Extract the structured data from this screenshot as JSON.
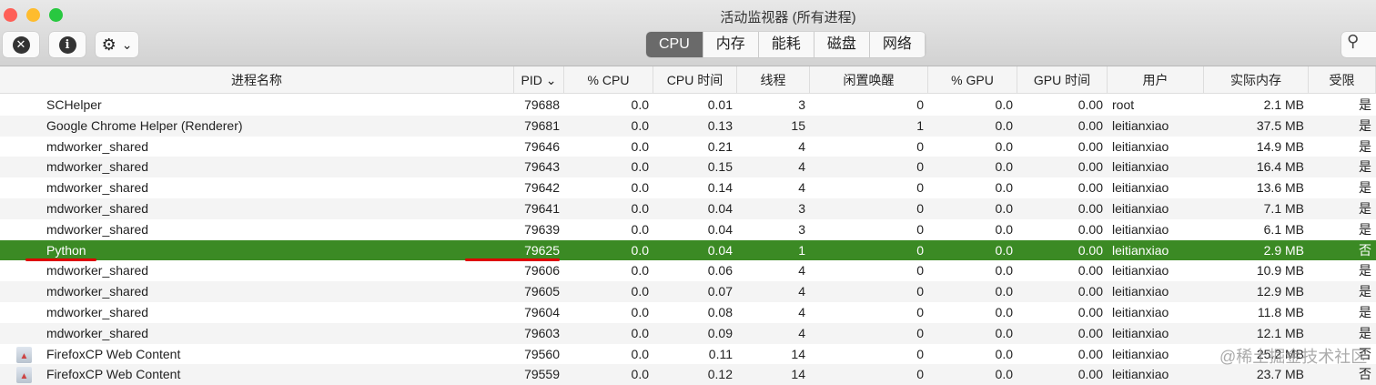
{
  "window": {
    "title": "活动监视器 (所有进程)"
  },
  "toolbar": {
    "stop_icon": "✕",
    "info_icon": "i",
    "gear_icon": "⚙",
    "chevron": "⌄",
    "search_icon": "⚲",
    "tabs": [
      "CPU",
      "内存",
      "能耗",
      "磁盘",
      "网络"
    ],
    "active_tab": "CPU"
  },
  "columns": [
    "进程名称",
    "PID ⌄",
    "% CPU",
    "CPU 时间",
    "线程",
    "闲置唤醒",
    "% GPU",
    "GPU 时间",
    "用户",
    "实际内存",
    "受限"
  ],
  "rows": [
    [
      "SCHelper",
      "79688",
      "0.0",
      "0.01",
      "3",
      "0",
      "0.0",
      "0.00",
      "root",
      "2.1 MB",
      "是"
    ],
    [
      "Google Chrome Helper (Renderer)",
      "79681",
      "0.0",
      "0.13",
      "15",
      "1",
      "0.0",
      "0.00",
      "leitianxiao",
      "37.5 MB",
      "是"
    ],
    [
      "mdworker_shared",
      "79646",
      "0.0",
      "0.21",
      "4",
      "0",
      "0.0",
      "0.00",
      "leitianxiao",
      "14.9 MB",
      "是"
    ],
    [
      "mdworker_shared",
      "79643",
      "0.0",
      "0.15",
      "4",
      "0",
      "0.0",
      "0.00",
      "leitianxiao",
      "16.4 MB",
      "是"
    ],
    [
      "mdworker_shared",
      "79642",
      "0.0",
      "0.14",
      "4",
      "0",
      "0.0",
      "0.00",
      "leitianxiao",
      "13.6 MB",
      "是"
    ],
    [
      "mdworker_shared",
      "79641",
      "0.0",
      "0.04",
      "3",
      "0",
      "0.0",
      "0.00",
      "leitianxiao",
      "7.1 MB",
      "是"
    ],
    [
      "mdworker_shared",
      "79639",
      "0.0",
      "0.04",
      "3",
      "0",
      "0.0",
      "0.00",
      "leitianxiao",
      "6.1 MB",
      "是"
    ],
    [
      "Python",
      "79625",
      "0.0",
      "0.04",
      "1",
      "0",
      "0.0",
      "0.00",
      "leitianxiao",
      "2.9 MB",
      "否"
    ],
    [
      "mdworker_shared",
      "79606",
      "0.0",
      "0.06",
      "4",
      "0",
      "0.0",
      "0.00",
      "leitianxiao",
      "10.9 MB",
      "是"
    ],
    [
      "mdworker_shared",
      "79605",
      "0.0",
      "0.07",
      "4",
      "0",
      "0.0",
      "0.00",
      "leitianxiao",
      "12.9 MB",
      "是"
    ],
    [
      "mdworker_shared",
      "79604",
      "0.0",
      "0.08",
      "4",
      "0",
      "0.0",
      "0.00",
      "leitianxiao",
      "11.8 MB",
      "是"
    ],
    [
      "mdworker_shared",
      "79603",
      "0.0",
      "0.09",
      "4",
      "0",
      "0.0",
      "0.00",
      "leitianxiao",
      "12.1 MB",
      "是"
    ],
    [
      "FirefoxCP Web Content",
      "79560",
      "0.0",
      "0.11",
      "14",
      "0",
      "0.0",
      "0.00",
      "leitianxiao",
      "25.2 MB",
      "否"
    ],
    [
      "FirefoxCP Web Content",
      "79559",
      "0.0",
      "0.12",
      "14",
      "0",
      "0.0",
      "0.00",
      "leitianxiao",
      "23.7 MB",
      "否"
    ]
  ],
  "selected_row": 7,
  "icon_rows": [
    12,
    13
  ],
  "watermark": "@稀土掘金技术社区"
}
